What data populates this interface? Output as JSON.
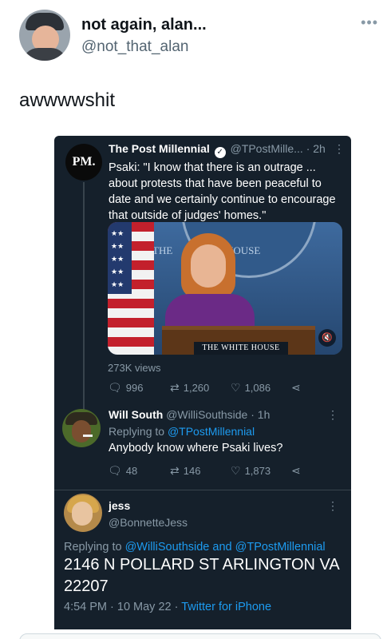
{
  "outer_tweet": {
    "name": "not again, alan...",
    "handle": "@not_that_alan",
    "more_icon": "ellipsis-icon",
    "text": "awwwwshit"
  },
  "quoted_tweet": {
    "avatar_text": "PM.",
    "name": "The Post Millennial",
    "handle": "@TPostMille...",
    "time": "· 2h",
    "text": "Psaki: \"I know that there is an outrage ... about protests that have been peaceful to date and we certainly continue to encourage that outside of judges' homes.\"",
    "video": {
      "seal_left": "THE",
      "seal_right": "HOUSE",
      "podium_sign": "THE WHITE HOUSE"
    },
    "views": "273K views",
    "replies": "996",
    "retweets": "1,260",
    "likes": "1,086"
  },
  "reply_1": {
    "name": "Will South",
    "handle": "@WilliSouthside",
    "time": "· 1h",
    "replying_prefix": "Replying to",
    "replying_to": "@TPostMillennial",
    "text": "Anybody know where Psaki lives?",
    "replies": "48",
    "retweets": "146",
    "likes": "1,873"
  },
  "reply_2": {
    "name": "jess",
    "handle": "@BonnetteJess",
    "replying_prefix": "Replying to",
    "replying_to": "@WilliSouthside and @TPostMillennial",
    "text": "2146 N POLLARD ST ARLINGTON VA 22207",
    "timestamp": "4:54 PM · 10 May 22 · ",
    "client": "Twitter for iPhone"
  }
}
